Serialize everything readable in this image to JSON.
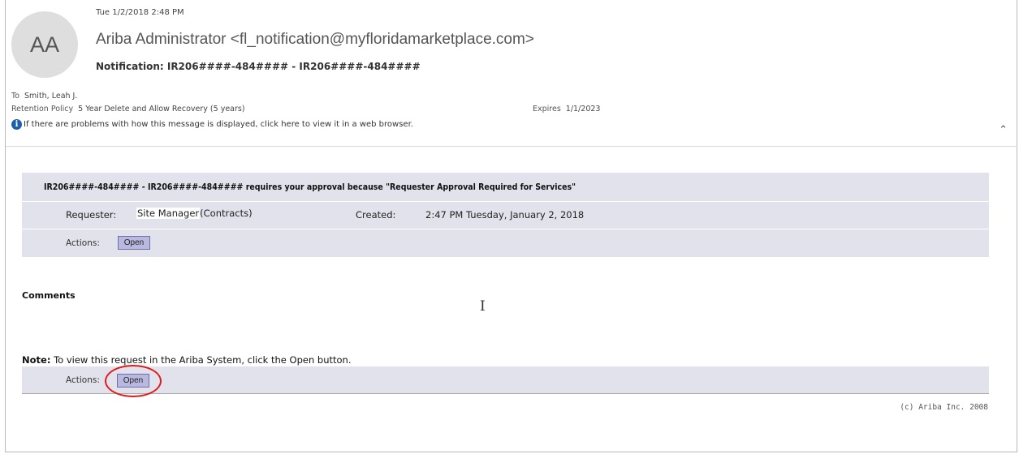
{
  "email": {
    "avatar_initials": "AA",
    "date": "Tue 1/2/2018 2:48 PM",
    "sender": "Ariba Administrator <fl_notification@myfloridamarketplace.com>",
    "subject": "Notification: IR206####-484####  - IR206####-484####",
    "to_label": "To",
    "to_value": "Smith, Leah J.",
    "retention_label": "Retention Policy",
    "retention_value": "5 Year Delete and Allow Recovery (5 years)",
    "expires_label": "Expires",
    "expires_value": "1/1/2023",
    "info_text": "If there are problems with how this message is displayed, click here to view it in a web browser."
  },
  "body": {
    "title": "IR206####-484#### - IR206####-484#### requires your approval because \"Requester Approval Required for Services\"",
    "requester_label": "Requester:",
    "requester_name": "Site Manager",
    "requester_dept": "(Contracts)",
    "created_label": "Created:",
    "created_value": "2:47 PM Tuesday, January 2, 2018",
    "actions_label": "Actions:",
    "open_label": "Open",
    "comments_heading": "Comments",
    "note_label": "Note:",
    "note_text": " To view this request in the Ariba System, click the Open button.",
    "copyright": "(c) Ariba Inc. 2008"
  },
  "colors": {
    "panel": "#e2e2ec",
    "button": "#b8b8e0",
    "annotation": "#e01b1b",
    "info_icon": "#1f5fa8"
  },
  "icons": [
    "info-icon",
    "chevron-up-icon",
    "text-cursor-icon"
  ]
}
